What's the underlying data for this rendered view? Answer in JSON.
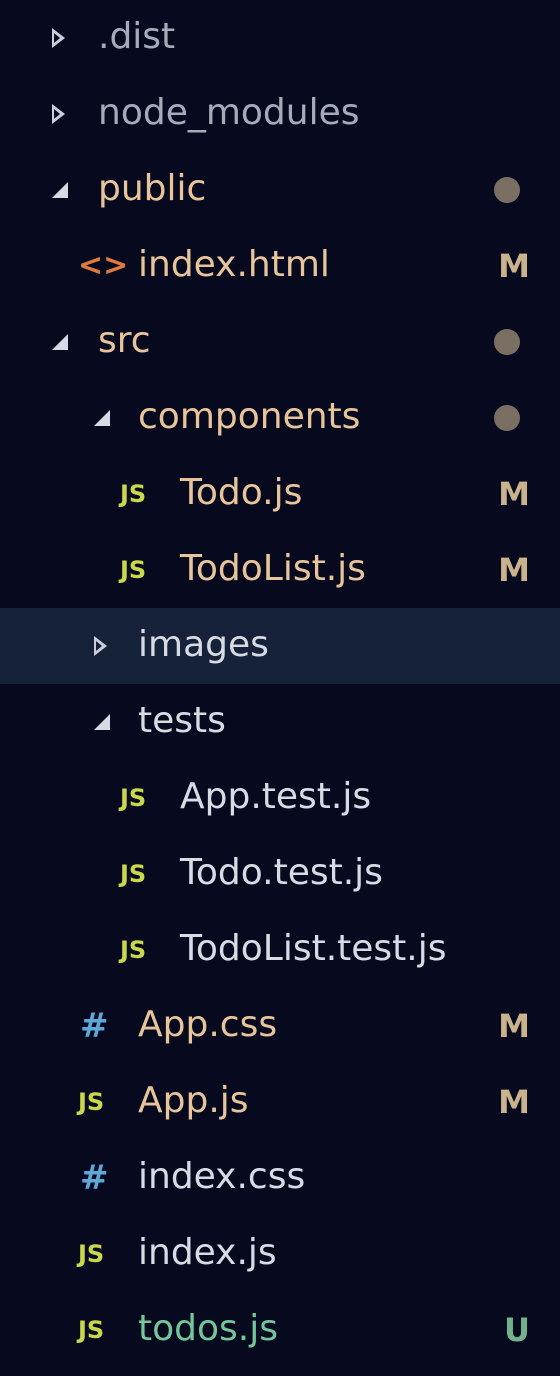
{
  "explorer": {
    "items": [
      {
        "label": ".dist",
        "kind": "folder",
        "state": "collapsed",
        "depth": 0,
        "status": "",
        "icon": "chevron-right-icon"
      },
      {
        "label": "node_modules",
        "kind": "folder",
        "state": "collapsed",
        "depth": 0,
        "status": "",
        "icon": "chevron-right-icon"
      },
      {
        "label": "public",
        "kind": "folder",
        "state": "expanded",
        "depth": 0,
        "status": "dot",
        "icon": "chevron-down-icon"
      },
      {
        "label": "index.html",
        "kind": "file",
        "depth": 1,
        "status": "M",
        "icon": "html-file-icon",
        "icon_text": "<>"
      },
      {
        "label": "src",
        "kind": "folder",
        "state": "expanded",
        "depth": 0,
        "status": "dot",
        "icon": "chevron-down-icon"
      },
      {
        "label": "components",
        "kind": "folder",
        "state": "expanded",
        "depth": 1,
        "status": "dot",
        "icon": "chevron-down-icon"
      },
      {
        "label": "Todo.js",
        "kind": "file",
        "depth": 2,
        "status": "M",
        "icon": "js-file-icon",
        "icon_text": "JS"
      },
      {
        "label": "TodoList.js",
        "kind": "file",
        "depth": 2,
        "status": "M",
        "icon": "js-file-icon",
        "icon_text": "JS"
      },
      {
        "label": "images",
        "kind": "folder",
        "state": "collapsed",
        "depth": 1,
        "status": "",
        "selected": true,
        "icon": "chevron-right-icon"
      },
      {
        "label": "tests",
        "kind": "folder",
        "state": "expanded",
        "depth": 1,
        "status": "",
        "icon": "chevron-down-icon"
      },
      {
        "label": "App.test.js",
        "kind": "file",
        "depth": 2,
        "status": "",
        "icon": "js-file-icon",
        "icon_text": "JS"
      },
      {
        "label": "Todo.test.js",
        "kind": "file",
        "depth": 2,
        "status": "",
        "icon": "js-file-icon",
        "icon_text": "JS"
      },
      {
        "label": "TodoList.test.js",
        "kind": "file",
        "depth": 2,
        "status": "",
        "icon": "js-file-icon",
        "icon_text": "JS"
      },
      {
        "label": "App.css",
        "kind": "file",
        "depth": 1,
        "status": "M",
        "icon": "css-file-icon",
        "icon_text": "#"
      },
      {
        "label": "App.js",
        "kind": "file",
        "depth": 1,
        "status": "M",
        "icon": "js-file-icon",
        "icon_text": "JS"
      },
      {
        "label": "index.css",
        "kind": "file",
        "depth": 1,
        "status": "",
        "icon": "css-file-icon",
        "icon_text": "#"
      },
      {
        "label": "index.js",
        "kind": "file",
        "depth": 1,
        "status": "",
        "icon": "js-file-icon",
        "icon_text": "JS"
      },
      {
        "label": "todos.js",
        "kind": "file",
        "depth": 1,
        "status": "U",
        "icon": "js-file-icon",
        "icon_text": "JS"
      }
    ]
  },
  "colors": {
    "background": "#070a1f",
    "selected_row": "#16223a",
    "modified_text": "#e8c49a",
    "untracked_text": "#74c79a",
    "folder_text": "#d7dbe3",
    "js_icon": "#c9d84a",
    "css_icon": "#5ea8d8",
    "html_icon": "#e07a3c",
    "modified_badge": "#c9b28c",
    "untracked_badge": "#74b08b",
    "dot": "#7a6f62"
  }
}
